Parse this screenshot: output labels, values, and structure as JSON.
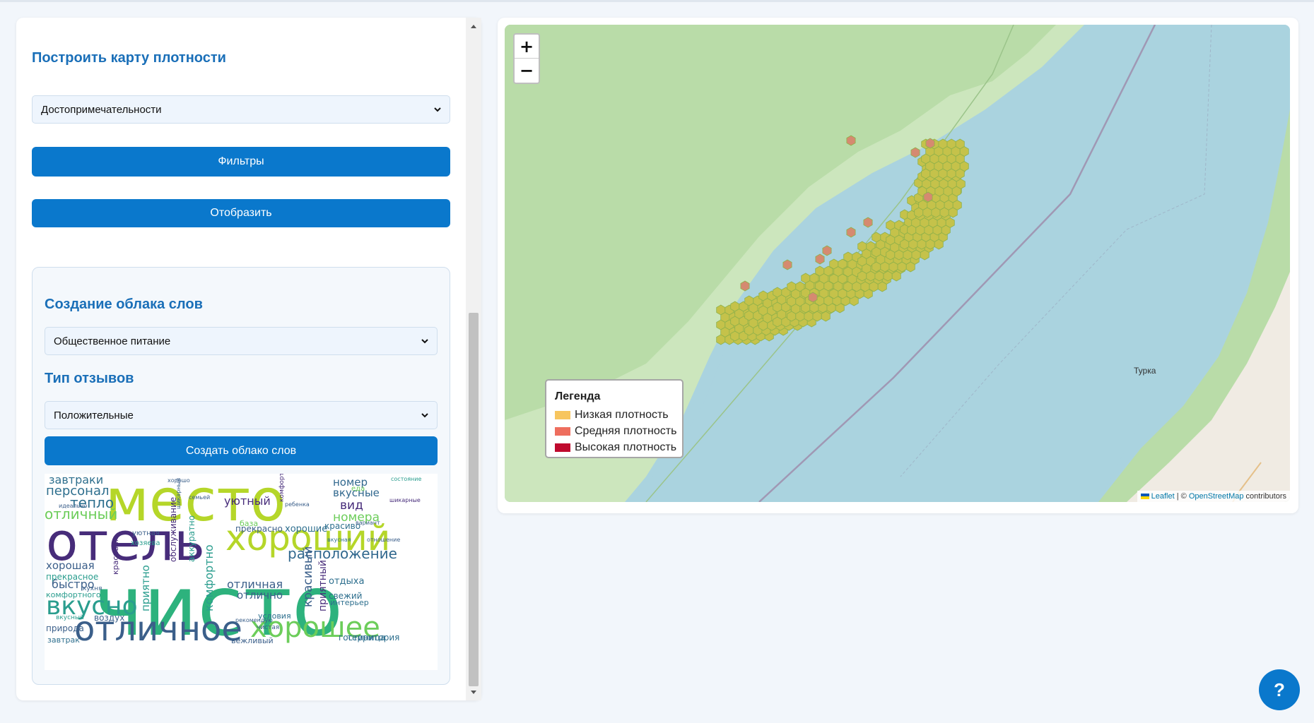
{
  "density_section": {
    "title": "Построить карту плотности",
    "category_select": "Достопримечательности",
    "filters_button": "Фильтры",
    "show_button": "Отобразить"
  },
  "wordcloud_section": {
    "title": "Создание облака слов",
    "category_select": "Общественное питание",
    "review_type_title": "Тип отзывов",
    "review_type_select": "Положительные",
    "create_button": "Создать облако слов",
    "words": [
      "место",
      "отель",
      "чисто",
      "хороший",
      "отличное",
      "хорошее",
      "вкусно",
      "расположение",
      "отличный",
      "персонал",
      "завтраки",
      "тепло",
      "номер",
      "вкусные",
      "вид",
      "номера",
      "уютный",
      "прекрасно",
      "хорошие",
      "красиво",
      "хорошая",
      "быстро",
      "прекрасное",
      "комфортного",
      "отличная",
      "отлично",
      "красивый",
      "приятный",
      "природа",
      "завтрак",
      "воздух",
      "территория",
      "гостиница",
      "вежливый",
      "условия",
      "свежий",
      "интерьер",
      "отдыха",
      "приятно",
      "комфортно",
      "обслуживание",
      "аккуратно",
      "база",
      "красивая",
      "уютная",
      "еда",
      "ребенка",
      "вкусная",
      "чистая",
      "рекомендую",
      "комфортные",
      "хозяева",
      "кухня",
      "вариант",
      "идеально",
      "шикарный",
      "состояние",
      "вкусный",
      "шикарные",
      "хорошо",
      "семьей",
      "отношение"
    ]
  },
  "map": {
    "zoom_in": "+",
    "zoom_out": "−",
    "legend": {
      "title": "Легенда",
      "items": [
        {
          "label": "Низкая плотность",
          "color": "#f7c55e"
        },
        {
          "label": "Средняя плотность",
          "color": "#ee6e5e"
        },
        {
          "label": "Высокая плотность",
          "color": "#bf0a2e"
        }
      ]
    },
    "place_label": "Турка",
    "attribution": {
      "leaflet": "Leaflet",
      "separator": " | © ",
      "osm": "OpenStreetMap",
      "suffix": " contributors"
    }
  },
  "help_button": "?"
}
